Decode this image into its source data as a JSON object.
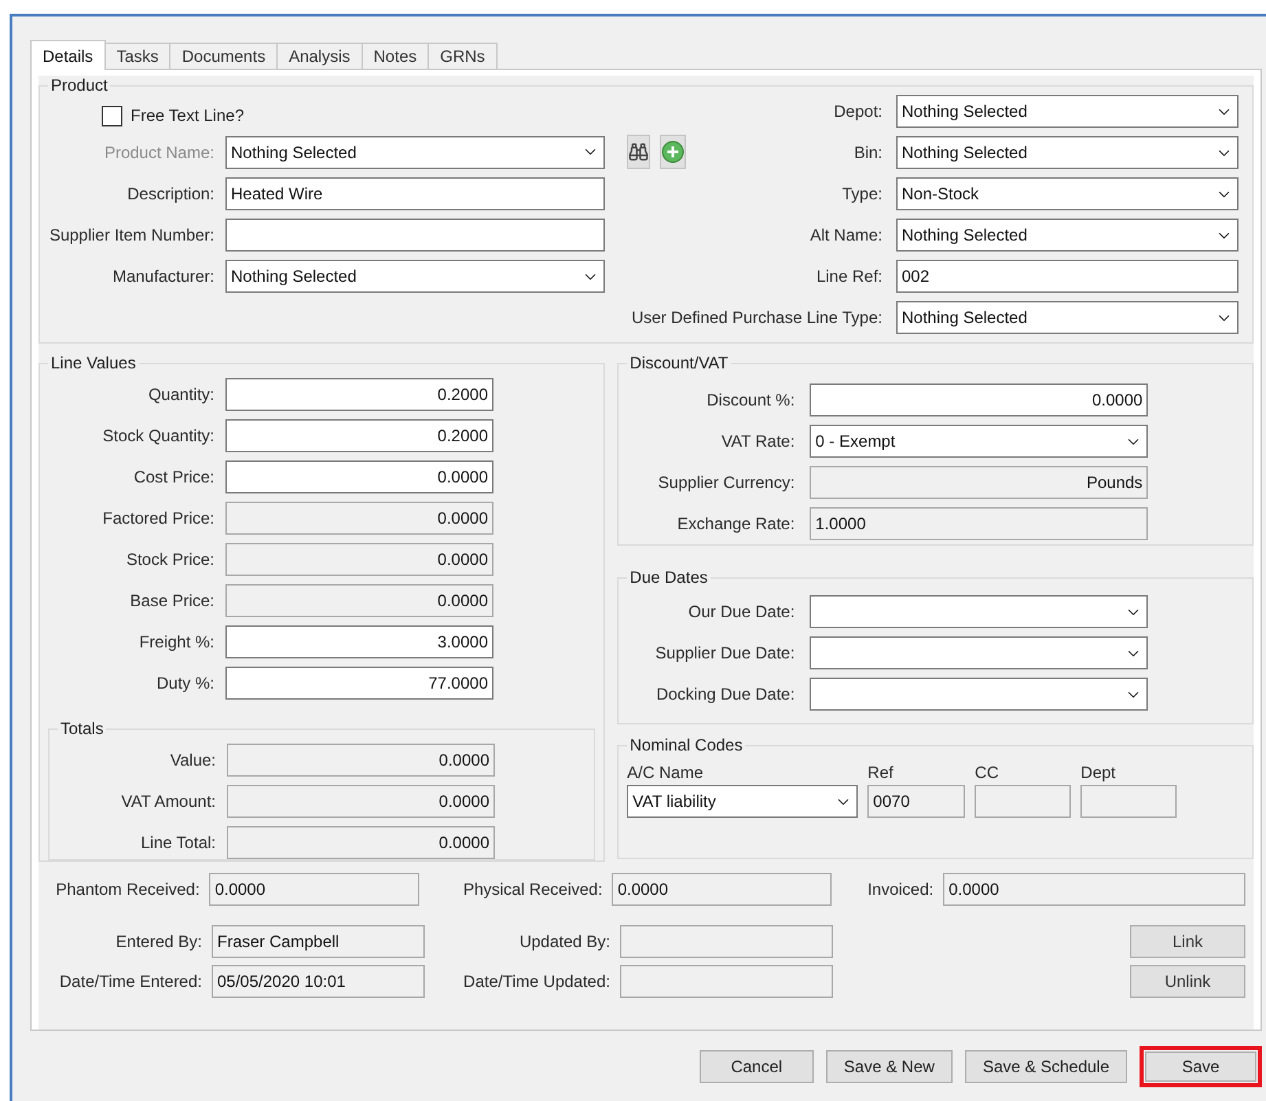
{
  "tabs": [
    {
      "label": "Details",
      "selected": true
    },
    {
      "label": "Tasks",
      "selected": false
    },
    {
      "label": "Documents",
      "selected": false
    },
    {
      "label": "Analysis",
      "selected": false
    },
    {
      "label": "Notes",
      "selected": false
    },
    {
      "label": "GRNs",
      "selected": false
    }
  ],
  "product": {
    "legend": "Product",
    "free_text_line": {
      "label": "Free Text Line?",
      "checked": false
    },
    "left_fields": [
      {
        "label": "Product Name:",
        "kind": "dropdown",
        "value": "Nothing Selected",
        "disabled": true
      },
      {
        "label": "Description:",
        "kind": "text",
        "value": "Heated Wire",
        "disabled": false
      },
      {
        "label": "Supplier Item Number:",
        "kind": "text",
        "disabled": false
      },
      {
        "label": "Manufacturer:",
        "kind": "dropdown",
        "value": "Nothing Selected",
        "disabled": false
      }
    ],
    "right_fields": [
      {
        "label": "Depot:",
        "kind": "dropdown",
        "value": "Nothing Selected"
      },
      {
        "label": "Bin:",
        "kind": "dropdown",
        "value": "Nothing Selected"
      },
      {
        "label": "Type:",
        "kind": "dropdown",
        "value": "Non-Stock"
      },
      {
        "label": "Alt Name:",
        "kind": "dropdown",
        "value": "Nothing Selected"
      },
      {
        "label": "Line Ref:",
        "kind": "text",
        "value": "002"
      },
      {
        "label": "User Defined Purchase Line Type:",
        "kind": "dropdown",
        "value": "Nothing Selected"
      }
    ]
  },
  "line_values": {
    "legend": "Line Values",
    "fields": [
      {
        "label": "Quantity:",
        "kind": "number",
        "value": "0.2000",
        "readonly": false
      },
      {
        "label": "Stock Quantity:",
        "kind": "number",
        "value": "0.2000",
        "readonly": false
      },
      {
        "label": "Cost Price:",
        "kind": "number",
        "value": "0.0000",
        "readonly": false
      },
      {
        "label": "Factored Price:",
        "kind": "number",
        "value": "0.0000",
        "readonly": true
      },
      {
        "label": "Stock Price:",
        "kind": "number",
        "value": "0.0000",
        "readonly": true
      },
      {
        "label": "Base Price:",
        "kind": "number",
        "value": "0.0000",
        "readonly": true
      },
      {
        "label": "Freight %:",
        "kind": "number",
        "value": "3.0000",
        "readonly": false
      },
      {
        "label": "Duty %:",
        "kind": "number",
        "value": "77.0000",
        "readonly": false
      }
    ]
  },
  "totals": {
    "legend": "Totals",
    "fields": [
      {
        "label": "Value:",
        "kind": "number",
        "value": "0.0000",
        "readonly": true
      },
      {
        "label": "VAT Amount:",
        "kind": "number",
        "value": "0.0000",
        "readonly": true
      },
      {
        "label": "Line Total:",
        "kind": "number",
        "value": "0.0000",
        "readonly": true
      }
    ]
  },
  "discount_vat": {
    "legend": "Discount/VAT",
    "fields": [
      {
        "label": "Discount %:",
        "kind": "number",
        "value": "0.0000",
        "readonly": false
      },
      {
        "label": "VAT Rate:",
        "kind": "dropdown",
        "value": "0 - Exempt",
        "readonly": false
      },
      {
        "label": "Supplier Currency:",
        "kind": "number",
        "value": "Pounds",
        "readonly": true
      },
      {
        "label": "Exchange Rate:",
        "kind": "text",
        "value": "1.0000",
        "readonly": true
      }
    ]
  },
  "due_dates": {
    "legend": "Due Dates",
    "fields": [
      {
        "label": "Our Due Date:",
        "kind": "dropdown"
      },
      {
        "label": "Supplier Due Date:",
        "kind": "dropdown"
      },
      {
        "label": "Docking Due Date:",
        "kind": "dropdown"
      }
    ]
  },
  "nominal_codes": {
    "legend": "Nominal Codes",
    "columns": [
      {
        "label": "A/C Name",
        "kind": "dropdown",
        "value": "VAT liability",
        "readonly": false
      },
      {
        "label": "Ref",
        "kind": "text",
        "value": "0070",
        "readonly": true
      },
      {
        "label": "CC",
        "kind": "text",
        "readonly": true
      },
      {
        "label": "Dept",
        "kind": "text",
        "readonly": true
      }
    ]
  },
  "footer_rows": [
    {
      "fields": [
        {
          "label": "Phantom Received:",
          "kind": "text",
          "value": "0.0000",
          "readonly": true
        },
        {
          "label": "Physical Received:",
          "kind": "text",
          "value": "0.0000",
          "readonly": true
        },
        {
          "label": "Invoiced:",
          "kind": "text",
          "value": "0.0000",
          "readonly": true
        }
      ]
    },
    {
      "fields": [
        {
          "label": "Entered By:",
          "kind": "text",
          "value": "Fraser Campbell",
          "readonly": true
        },
        {
          "label": "Updated By:",
          "kind": "text",
          "readonly": true
        }
      ],
      "button": "Link"
    },
    {
      "fields": [
        {
          "label": "Date/Time Entered:",
          "kind": "text",
          "value": "05/05/2020 10:01",
          "readonly": true
        },
        {
          "label": "Date/Time Updated:",
          "kind": "text",
          "readonly": true
        }
      ],
      "button": "Unlink"
    }
  ],
  "buttons": [
    {
      "label": "Cancel",
      "highlighted": false
    },
    {
      "label": "Save & New",
      "highlighted": false
    },
    {
      "label": "Save & Schedule",
      "highlighted": false
    },
    {
      "label": "Save",
      "highlighted": true
    }
  ]
}
